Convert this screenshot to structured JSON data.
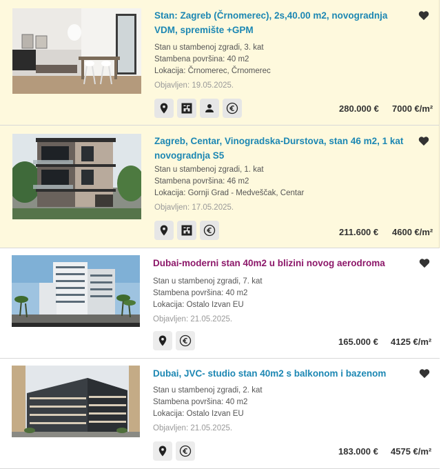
{
  "colors": {
    "featured_bg": "#fef9dd",
    "title_link": "#1c87b3",
    "title_visited": "#8c1769",
    "meta_text": "#555555",
    "date_text": "#999999"
  },
  "listings": [
    {
      "title": "Stan: Zagreb (Črnomerec), 2s,40.00 m2, novogradnja VDM, spremište +GPM",
      "type": "Stan u stambenoj zgradi, 3. kat",
      "area": "Stambena površina: 40 m2",
      "location": "Lokacija: Črnomerec, Črnomerec",
      "published": "Objavljen: 19.05.2025.",
      "price": "280.000 €",
      "price_per_m2": "7000 €/m²",
      "icons": [
        "location-pin-icon",
        "floor-plan-icon",
        "agent-person-icon",
        "euro-icon"
      ]
    },
    {
      "title": "Zagreb, Centar, Vinogradska-Durstova, stan 46 m2, 1 kat novogradnja S5",
      "type": "Stan u stambenoj zgradi, 1. kat",
      "area": "Stambena površina: 46 m2",
      "location": "Lokacija: Gornji Grad - Medveščak, Centar",
      "published": "Objavljen: 17.05.2025.",
      "price": "211.600 €",
      "price_per_m2": "4600 €/m²",
      "icons": [
        "location-pin-icon",
        "floor-plan-icon",
        "euro-icon"
      ]
    },
    {
      "title": "Dubai-moderni stan 40m2 u blizini novog aerodroma",
      "type": "Stan u stambenoj zgradi, 7. kat",
      "area": "Stambena površina: 40 m2",
      "location": "Lokacija: Ostalo Izvan EU",
      "published": "Objavljen: 21.05.2025.",
      "price": "165.000 €",
      "price_per_m2": "4125 €/m²",
      "icons": [
        "location-pin-icon",
        "euro-icon"
      ]
    },
    {
      "title": "Dubai, JVC- studio stan 40m2 s balkonom i bazenom",
      "type": "Stan u stambenoj zgradi, 2. kat",
      "area": "Stambena površina: 40 m2",
      "location": "Lokacija: Ostalo Izvan EU",
      "published": "Objavljen: 21.05.2025.",
      "price": "183.000 €",
      "price_per_m2": "4575 €/m²",
      "icons": [
        "location-pin-icon",
        "euro-icon"
      ]
    }
  ]
}
